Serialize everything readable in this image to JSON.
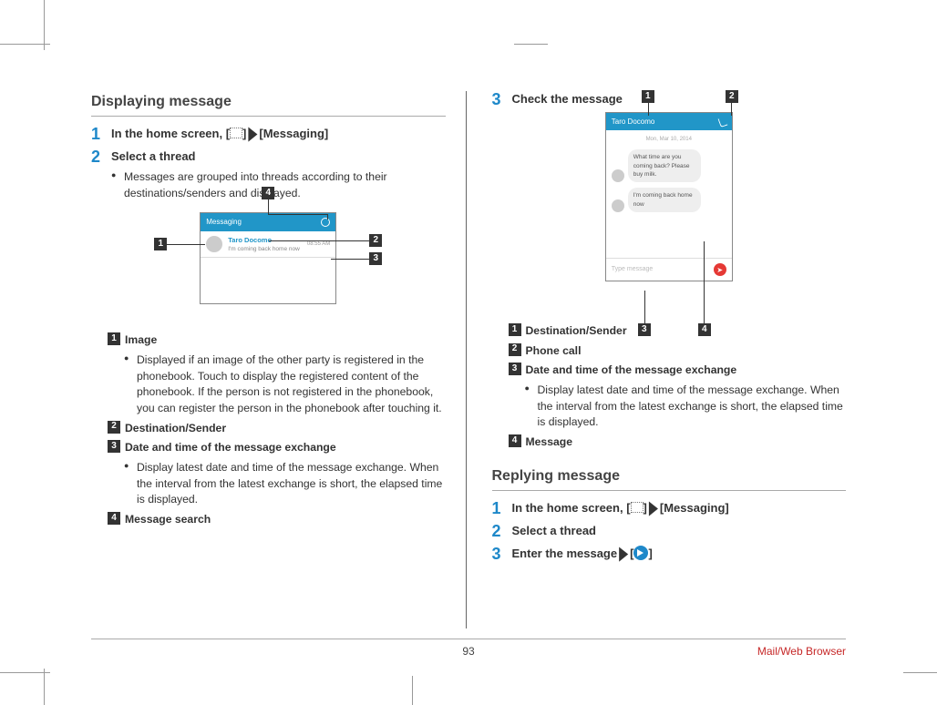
{
  "left": {
    "section_title": "Displaying message",
    "step1": {
      "num": "1",
      "pre": "In the home screen, [",
      "post": "]",
      "arrow": "▶",
      "target": "[Messaging]"
    },
    "step2": {
      "num": "2",
      "title": "Select a thread",
      "bullet": "Messages are grouped into threads according to their destinations/senders and displayed."
    },
    "fig1": {
      "header": "Messaging",
      "thread_name": "Taro Docomo",
      "thread_preview": "I'm coming back home now",
      "thread_date": "08:55 AM",
      "callouts": {
        "c1": "1",
        "c2": "2",
        "c3": "3",
        "c4": "4"
      }
    },
    "legend": {
      "l1": {
        "num": "1",
        "label": "Image",
        "desc": "Displayed if an image of the other party is registered in the phonebook. Touch to display the registered content of the phonebook. If the person is not registered in the phonebook, you can register the person in the phonebook after touching it."
      },
      "l2": {
        "num": "2",
        "label": "Destination/Sender"
      },
      "l3": {
        "num": "3",
        "label": "Date and time of the message exchange",
        "desc": "Display latest date and time of the message exchange. When the interval from the latest exchange is short, the elapsed time is displayed."
      },
      "l4": {
        "num": "4",
        "label": "Message search"
      }
    }
  },
  "right": {
    "step3": {
      "num": "3",
      "title": "Check the message"
    },
    "fig2": {
      "header_name": "Taro Docomo",
      "date": "Mon, Mar 10, 2014",
      "bubble1": "What time are you coming back? Please buy milk.",
      "bubble2": "I'm coming back home now",
      "input_placeholder": "Type message",
      "callouts": {
        "c1": "1",
        "c2": "2",
        "c3": "3",
        "c4": "4"
      }
    },
    "legend": {
      "l1": {
        "num": "1",
        "label": "Destination/Sender"
      },
      "l2": {
        "num": "2",
        "label": "Phone call"
      },
      "l3": {
        "num": "3",
        "label": "Date and time of the message exchange",
        "desc": "Display latest date and time of the message exchange. When the interval from the latest exchange is short, the elapsed time is displayed."
      },
      "l4": {
        "num": "4",
        "label": "Message"
      }
    },
    "replying": {
      "section_title": "Replying message",
      "step1": {
        "num": "1",
        "pre": "In the home screen, [",
        "post": "]",
        "arrow": "▶",
        "target": "[Messaging]"
      },
      "step2": {
        "num": "2",
        "title": "Select a thread"
      },
      "step3": {
        "num": "3",
        "pre": "Enter the message",
        "arrow": "▶",
        "bracket_open": "[",
        "bracket_close": "]"
      }
    }
  },
  "footer": {
    "page": "93",
    "section": "Mail/Web Browser"
  }
}
